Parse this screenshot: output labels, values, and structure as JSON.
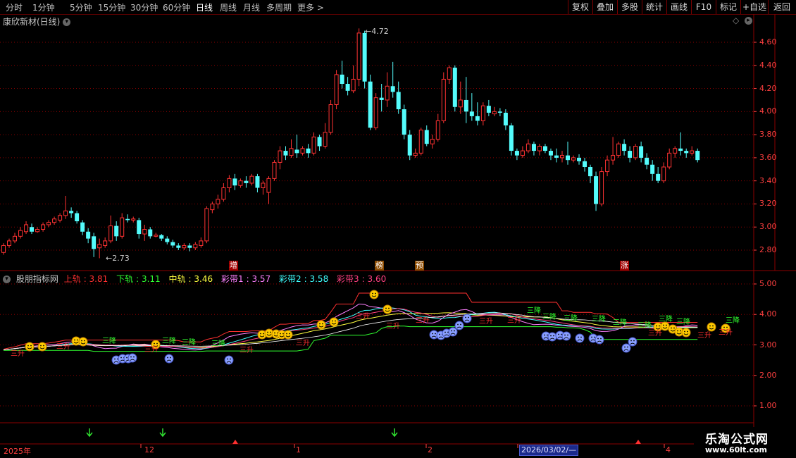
{
  "toolbar": {
    "periods": [
      "分时",
      "1分钟",
      "5分钟",
      "15分钟",
      "30分钟",
      "60分钟",
      "日线",
      "周线",
      "月线",
      "多周期",
      "更多 >"
    ],
    "active_period": "日线",
    "right_buttons": [
      "复权",
      "叠加",
      "多股",
      "统计",
      "画线",
      "F10",
      "标记",
      "+自选",
      "返回"
    ]
  },
  "main_chart": {
    "title": "康欣新材(日线)",
    "high_label": "4.72",
    "low_label": "2.73",
    "price_axis": [
      "4.60",
      "4.40",
      "4.20",
      "4.00",
      "3.80",
      "3.60",
      "3.40",
      "3.20",
      "3.00",
      "2.80"
    ],
    "tags": [
      "增",
      "榜",
      "预",
      "涨"
    ],
    "candles": [
      [
        2.78,
        2.84,
        2.76,
        2.86
      ],
      [
        2.84,
        2.88,
        2.82,
        2.9
      ],
      [
        2.88,
        2.92,
        2.86,
        2.95
      ],
      [
        2.92,
        2.97,
        2.9,
        3.0
      ],
      [
        2.96,
        3.02,
        2.94,
        3.05
      ],
      [
        3.0,
        2.96,
        2.94,
        3.03
      ],
      [
        2.96,
        2.98,
        2.95,
        3.0
      ],
      [
        2.98,
        3.02,
        2.96,
        3.04
      ],
      [
        3.02,
        3.04,
        3.0,
        3.06
      ],
      [
        3.04,
        3.07,
        3.02,
        3.09
      ],
      [
        3.06,
        3.1,
        3.04,
        3.12
      ],
      [
        3.1,
        3.14,
        3.07,
        3.27
      ],
      [
        3.14,
        3.12,
        3.08,
        3.17
      ],
      [
        3.12,
        3.05,
        3.03,
        3.14
      ],
      [
        3.04,
        2.96,
        2.93,
        3.06
      ],
      [
        2.96,
        2.9,
        2.86,
        2.99
      ],
      [
        2.92,
        2.81,
        2.74,
        2.95
      ],
      [
        2.82,
        2.85,
        2.73,
        2.9
      ],
      [
        2.84,
        2.88,
        2.82,
        2.91
      ],
      [
        2.88,
        3.01,
        2.86,
        3.1
      ],
      [
        3.01,
        2.92,
        2.88,
        3.05
      ],
      [
        2.92,
        3.08,
        2.9,
        3.12
      ],
      [
        3.07,
        3.06,
        3.04,
        3.11
      ],
      [
        3.06,
        3.07,
        3.04,
        3.09
      ],
      [
        3.06,
        2.94,
        2.9,
        3.08
      ],
      [
        2.94,
        2.98,
        2.88,
        3.02
      ],
      [
        2.98,
        2.92,
        2.9,
        3.0
      ],
      [
        2.92,
        2.93,
        2.91,
        2.95
      ],
      [
        2.93,
        2.9,
        2.88,
        2.94
      ],
      [
        2.9,
        2.87,
        2.85,
        2.92
      ],
      [
        2.87,
        2.84,
        2.82,
        2.89
      ],
      [
        2.84,
        2.82,
        2.8,
        2.86
      ],
      [
        2.82,
        2.84,
        2.8,
        2.86
      ],
      [
        2.84,
        2.82,
        2.79,
        2.86
      ],
      [
        2.82,
        2.85,
        2.8,
        2.87
      ],
      [
        2.84,
        2.88,
        2.82,
        2.91
      ],
      [
        2.88,
        3.16,
        2.86,
        3.18
      ],
      [
        3.15,
        3.2,
        3.12,
        3.22
      ],
      [
        3.2,
        3.24,
        3.16,
        3.28
      ],
      [
        3.24,
        3.34,
        3.22,
        3.38
      ],
      [
        3.34,
        3.42,
        3.3,
        3.45
      ],
      [
        3.42,
        3.36,
        3.32,
        3.46
      ],
      [
        3.36,
        3.4,
        3.34,
        3.42
      ],
      [
        3.4,
        3.38,
        3.34,
        3.44
      ],
      [
        3.38,
        3.44,
        3.36,
        3.46
      ],
      [
        3.44,
        3.34,
        3.3,
        3.46
      ],
      [
        3.34,
        3.38,
        3.28,
        3.4
      ],
      [
        3.3,
        3.42,
        3.2,
        3.44
      ],
      [
        3.42,
        3.56,
        3.4,
        3.58
      ],
      [
        3.56,
        3.66,
        3.5,
        3.7
      ],
      [
        3.66,
        3.62,
        3.58,
        3.7
      ],
      [
        3.62,
        3.68,
        3.6,
        3.76
      ],
      [
        3.67,
        3.64,
        3.6,
        3.8
      ],
      [
        3.64,
        3.68,
        3.62,
        3.7
      ],
      [
        3.68,
        3.64,
        3.6,
        3.72
      ],
      [
        3.64,
        3.78,
        3.62,
        3.82
      ],
      [
        3.78,
        3.7,
        3.66,
        3.8
      ],
      [
        3.7,
        3.82,
        3.68,
        3.9
      ],
      [
        3.82,
        4.06,
        3.8,
        4.1
      ],
      [
        4.06,
        4.32,
        4.02,
        4.36
      ],
      [
        4.32,
        4.24,
        4.2,
        4.44
      ],
      [
        4.24,
        4.18,
        4.14,
        4.3
      ],
      [
        4.18,
        4.28,
        4.16,
        4.4
      ],
      [
        4.28,
        4.68,
        4.22,
        4.72
      ],
      [
        4.68,
        4.26,
        4.2,
        4.7
      ],
      [
        4.26,
        3.86,
        3.84,
        4.32
      ],
      [
        3.86,
        4.12,
        3.84,
        4.16
      ],
      [
        4.12,
        4.1,
        4.0,
        4.24
      ],
      [
        4.1,
        4.22,
        4.04,
        4.34
      ],
      [
        4.22,
        4.17,
        4.12,
        4.43
      ],
      [
        4.17,
        4.02,
        3.98,
        4.26
      ],
      [
        4.02,
        3.8,
        3.76,
        4.06
      ],
      [
        3.8,
        3.62,
        3.58,
        3.84
      ],
      [
        3.62,
        3.64,
        3.6,
        3.68
      ],
      [
        3.64,
        3.84,
        3.62,
        3.86
      ],
      [
        3.84,
        3.72,
        3.7,
        3.88
      ],
      [
        3.72,
        3.76,
        3.68,
        3.8
      ],
      [
        3.76,
        3.92,
        3.74,
        3.98
      ],
      [
        3.92,
        4.28,
        3.9,
        4.34
      ],
      [
        4.28,
        4.38,
        4.24,
        4.4
      ],
      [
        4.38,
        4.04,
        4.0,
        4.4
      ],
      [
        4.04,
        4.1,
        3.98,
        4.26
      ],
      [
        4.1,
        4.0,
        3.9,
        4.3
      ],
      [
        4.0,
        3.96,
        3.92,
        4.16
      ],
      [
        3.96,
        3.92,
        3.88,
        4.08
      ],
      [
        3.92,
        4.05,
        3.88,
        4.08
      ],
      [
        4.05,
        3.99,
        3.96,
        4.1
      ],
      [
        3.98,
        4.0,
        3.96,
        4.04
      ],
      [
        4.0,
        3.99,
        3.96,
        4.03
      ],
      [
        3.99,
        3.88,
        3.84,
        4.02
      ],
      [
        3.88,
        3.66,
        3.62,
        3.9
      ],
      [
        3.66,
        3.62,
        3.58,
        3.68
      ],
      [
        3.62,
        3.66,
        3.6,
        3.7
      ],
      [
        3.66,
        3.72,
        3.64,
        3.76
      ],
      [
        3.72,
        3.66,
        3.62,
        3.74
      ],
      [
        3.66,
        3.7,
        3.62,
        3.72
      ],
      [
        3.7,
        3.66,
        3.64,
        3.72
      ],
      [
        3.66,
        3.62,
        3.58,
        3.68
      ],
      [
        3.62,
        3.6,
        3.56,
        3.68
      ],
      [
        3.6,
        3.62,
        3.56,
        3.66
      ],
      [
        3.62,
        3.58,
        3.54,
        3.74
      ],
      [
        3.58,
        3.6,
        3.56,
        3.62
      ],
      [
        3.6,
        3.57,
        3.54,
        3.63
      ],
      [
        3.57,
        3.52,
        3.48,
        3.6
      ],
      [
        3.52,
        3.44,
        3.38,
        3.54
      ],
      [
        3.44,
        3.2,
        3.14,
        3.48
      ],
      [
        3.2,
        3.48,
        3.18,
        3.52
      ],
      [
        3.48,
        3.58,
        3.44,
        3.62
      ],
      [
        3.58,
        3.62,
        3.54,
        3.78
      ],
      [
        3.62,
        3.72,
        3.6,
        3.74
      ],
      [
        3.72,
        3.66,
        3.62,
        3.76
      ],
      [
        3.66,
        3.6,
        3.56,
        3.7
      ],
      [
        3.6,
        3.7,
        3.58,
        3.72
      ],
      [
        3.7,
        3.6,
        3.56,
        3.74
      ],
      [
        3.6,
        3.54,
        3.5,
        3.64
      ],
      [
        3.54,
        3.46,
        3.4,
        3.58
      ],
      [
        3.46,
        3.4,
        3.38,
        3.52
      ],
      [
        3.4,
        3.52,
        3.38,
        3.56
      ],
      [
        3.52,
        3.64,
        3.5,
        3.68
      ],
      [
        3.64,
        3.68,
        3.6,
        3.7
      ],
      [
        3.68,
        3.66,
        3.62,
        3.82
      ],
      [
        3.66,
        3.64,
        3.6,
        3.68
      ],
      [
        3.64,
        3.66,
        3.62,
        3.7
      ],
      [
        3.66,
        3.58,
        3.56,
        3.68
      ]
    ]
  },
  "indicator": {
    "title": "股朋指标网",
    "lines": [
      {
        "name": "上轨",
        "value": "3.81",
        "color": "#ff3030"
      },
      {
        "name": "下轨",
        "value": "3.11",
        "color": "#30ff30"
      },
      {
        "name": "中轨",
        "value": "3.46",
        "color": "#ffff40"
      },
      {
        "name": "彩带1",
        "value": "3.57",
        "color": "#ff80ff"
      },
      {
        "name": "彩带2",
        "value": "3.58",
        "color": "#40ffff"
      },
      {
        "name": "彩带3",
        "value": "3.60",
        "color": "#ff4080"
      }
    ],
    "axis": [
      "5.00",
      "4.00",
      "3.00",
      "2.00",
      "1.00"
    ],
    "up_label": "三升",
    "down_label": "三降"
  },
  "date_axis": {
    "labels": [
      "2025年",
      "12",
      "1",
      "2",
      "4"
    ],
    "cursor_date": "2026/03/02/—"
  },
  "logo": {
    "line1": "乐淘公式网",
    "line2": "www.60lt.com"
  },
  "colors": {
    "up": "#ff3232",
    "down": "#54fcfc",
    "grid": "#8b0000",
    "axis": "#ff4040"
  }
}
